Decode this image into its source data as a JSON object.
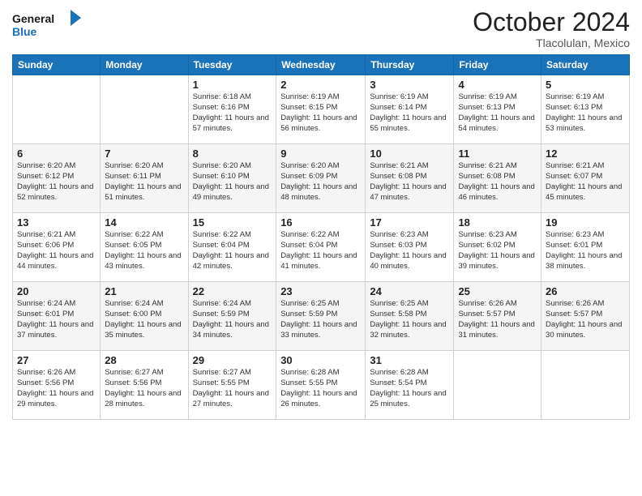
{
  "header": {
    "logo_line1": "General",
    "logo_line2": "Blue",
    "month": "October 2024",
    "location": "Tlacolulan, Mexico"
  },
  "weekdays": [
    "Sunday",
    "Monday",
    "Tuesday",
    "Wednesday",
    "Thursday",
    "Friday",
    "Saturday"
  ],
  "weeks": [
    [
      {
        "day": "",
        "info": ""
      },
      {
        "day": "",
        "info": ""
      },
      {
        "day": "1",
        "info": "Sunrise: 6:18 AM\nSunset: 6:16 PM\nDaylight: 11 hours and 57 minutes."
      },
      {
        "day": "2",
        "info": "Sunrise: 6:19 AM\nSunset: 6:15 PM\nDaylight: 11 hours and 56 minutes."
      },
      {
        "day": "3",
        "info": "Sunrise: 6:19 AM\nSunset: 6:14 PM\nDaylight: 11 hours and 55 minutes."
      },
      {
        "day": "4",
        "info": "Sunrise: 6:19 AM\nSunset: 6:13 PM\nDaylight: 11 hours and 54 minutes."
      },
      {
        "day": "5",
        "info": "Sunrise: 6:19 AM\nSunset: 6:13 PM\nDaylight: 11 hours and 53 minutes."
      }
    ],
    [
      {
        "day": "6",
        "info": "Sunrise: 6:20 AM\nSunset: 6:12 PM\nDaylight: 11 hours and 52 minutes."
      },
      {
        "day": "7",
        "info": "Sunrise: 6:20 AM\nSunset: 6:11 PM\nDaylight: 11 hours and 51 minutes."
      },
      {
        "day": "8",
        "info": "Sunrise: 6:20 AM\nSunset: 6:10 PM\nDaylight: 11 hours and 49 minutes."
      },
      {
        "day": "9",
        "info": "Sunrise: 6:20 AM\nSunset: 6:09 PM\nDaylight: 11 hours and 48 minutes."
      },
      {
        "day": "10",
        "info": "Sunrise: 6:21 AM\nSunset: 6:08 PM\nDaylight: 11 hours and 47 minutes."
      },
      {
        "day": "11",
        "info": "Sunrise: 6:21 AM\nSunset: 6:08 PM\nDaylight: 11 hours and 46 minutes."
      },
      {
        "day": "12",
        "info": "Sunrise: 6:21 AM\nSunset: 6:07 PM\nDaylight: 11 hours and 45 minutes."
      }
    ],
    [
      {
        "day": "13",
        "info": "Sunrise: 6:21 AM\nSunset: 6:06 PM\nDaylight: 11 hours and 44 minutes."
      },
      {
        "day": "14",
        "info": "Sunrise: 6:22 AM\nSunset: 6:05 PM\nDaylight: 11 hours and 43 minutes."
      },
      {
        "day": "15",
        "info": "Sunrise: 6:22 AM\nSunset: 6:04 PM\nDaylight: 11 hours and 42 minutes."
      },
      {
        "day": "16",
        "info": "Sunrise: 6:22 AM\nSunset: 6:04 PM\nDaylight: 11 hours and 41 minutes."
      },
      {
        "day": "17",
        "info": "Sunrise: 6:23 AM\nSunset: 6:03 PM\nDaylight: 11 hours and 40 minutes."
      },
      {
        "day": "18",
        "info": "Sunrise: 6:23 AM\nSunset: 6:02 PM\nDaylight: 11 hours and 39 minutes."
      },
      {
        "day": "19",
        "info": "Sunrise: 6:23 AM\nSunset: 6:01 PM\nDaylight: 11 hours and 38 minutes."
      }
    ],
    [
      {
        "day": "20",
        "info": "Sunrise: 6:24 AM\nSunset: 6:01 PM\nDaylight: 11 hours and 37 minutes."
      },
      {
        "day": "21",
        "info": "Sunrise: 6:24 AM\nSunset: 6:00 PM\nDaylight: 11 hours and 35 minutes."
      },
      {
        "day": "22",
        "info": "Sunrise: 6:24 AM\nSunset: 5:59 PM\nDaylight: 11 hours and 34 minutes."
      },
      {
        "day": "23",
        "info": "Sunrise: 6:25 AM\nSunset: 5:59 PM\nDaylight: 11 hours and 33 minutes."
      },
      {
        "day": "24",
        "info": "Sunrise: 6:25 AM\nSunset: 5:58 PM\nDaylight: 11 hours and 32 minutes."
      },
      {
        "day": "25",
        "info": "Sunrise: 6:26 AM\nSunset: 5:57 PM\nDaylight: 11 hours and 31 minutes."
      },
      {
        "day": "26",
        "info": "Sunrise: 6:26 AM\nSunset: 5:57 PM\nDaylight: 11 hours and 30 minutes."
      }
    ],
    [
      {
        "day": "27",
        "info": "Sunrise: 6:26 AM\nSunset: 5:56 PM\nDaylight: 11 hours and 29 minutes."
      },
      {
        "day": "28",
        "info": "Sunrise: 6:27 AM\nSunset: 5:56 PM\nDaylight: 11 hours and 28 minutes."
      },
      {
        "day": "29",
        "info": "Sunrise: 6:27 AM\nSunset: 5:55 PM\nDaylight: 11 hours and 27 minutes."
      },
      {
        "day": "30",
        "info": "Sunrise: 6:28 AM\nSunset: 5:55 PM\nDaylight: 11 hours and 26 minutes."
      },
      {
        "day": "31",
        "info": "Sunrise: 6:28 AM\nSunset: 5:54 PM\nDaylight: 11 hours and 25 minutes."
      },
      {
        "day": "",
        "info": ""
      },
      {
        "day": "",
        "info": ""
      }
    ]
  ]
}
